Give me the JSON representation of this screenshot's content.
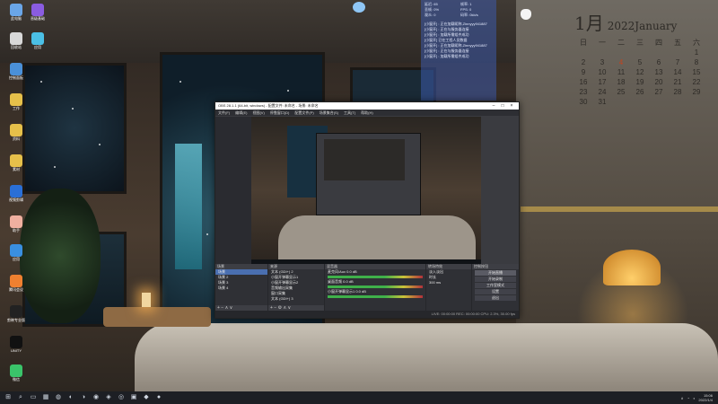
{
  "desktop": {
    "icons": [
      {
        "label": "此电脑",
        "color": "#6aa6e8"
      },
      {
        "label": "晋级基础",
        "color": "#8a5ce0"
      },
      {
        "label": "回收站",
        "color": "#d8d8d8"
      },
      {
        "label": "应用",
        "color": "#4bc0e6"
      },
      {
        "label": "控制面板",
        "color": "#4a90d8"
      },
      {
        "label": "工作",
        "color": "#e6c04a"
      },
      {
        "label": "资料",
        "color": "#e6c04a"
      },
      {
        "label": "素材",
        "color": "#e6c04a"
      },
      {
        "label": "视频剪辑",
        "color": "#2a6fd6"
      },
      {
        "label": "助手",
        "color": "#f0b0a0"
      },
      {
        "label": "应用",
        "color": "#3a8fe0"
      },
      {
        "label": "腾讯会议",
        "color": "#f08030"
      },
      {
        "label": "剪映专业版",
        "color": "#222222"
      },
      {
        "label": "UNITY",
        "color": "#111111"
      },
      {
        "label": "微信",
        "color": "#3ac46a"
      }
    ]
  },
  "calendar": {
    "month": "1月",
    "year_label": "2022January",
    "weekdays": [
      "日",
      "一",
      "二",
      "三",
      "四",
      "五",
      "六"
    ],
    "days": [
      "",
      "",
      "",
      "",
      "",
      "",
      "1",
      "2",
      "3",
      "4",
      "5",
      "6",
      "7",
      "8",
      "9",
      "10",
      "11",
      "12",
      "13",
      "14",
      "15",
      "16",
      "17",
      "18",
      "19",
      "20",
      "21",
      "22",
      "23",
      "24",
      "25",
      "26",
      "27",
      "28",
      "29",
      "30",
      "31",
      "",
      "",
      "",
      "",
      ""
    ],
    "highlight": "4"
  },
  "overlay": {
    "stats": [
      "延迟: 65",
      "帧率: 1",
      "丢帧: 0%",
      "FPS: 0",
      "观众: 0",
      "码率: 0kb/s"
    ],
    "messages": [
      "[小窗开] : 正在加载昵称,Zinnyyy941887",
      "[小窗开] : 正在与服务器连接",
      "[小窗开] : 加载所需组件成功",
      "[小窗开] 已在工程人员数据",
      "[小窗开] : 正在加载昵称,Zinnyyy941887",
      "[小窗开] : 正在与服务器连接",
      "[小窗开] : 加载所需组件成功"
    ]
  },
  "obs": {
    "title": "OBS 28.1.1 (64-bit, windows) - 配置文件: 未命名 - 场景: 未命名",
    "menu": [
      "文件(F)",
      "编辑(E)",
      "视图(V)",
      "停靠窗口(D)",
      "配置文件(P)",
      "场景集合(S)",
      "工具(T)",
      "帮助(H)"
    ],
    "docks": {
      "scenes": {
        "header": "场景",
        "items": [
          "场景",
          "场景 2",
          "场景 3",
          "场景 4"
        ]
      },
      "sources": {
        "header": "来源",
        "items": [
          "文本 (GDI+) 2",
          "小窗开弹幕显示1",
          "小窗开弹幕显示2",
          "音频输出采集",
          "窗口采集",
          "文本 (GDI+) 3"
        ]
      },
      "mixer": {
        "header": "混音器",
        "items": [
          "麦克风/Aux",
          "桌面音频",
          "小窗开弹幕显示1"
        ],
        "levels": [
          "0.0 dB",
          "0.0 dB",
          "0.0 dB"
        ]
      },
      "transitions": {
        "header": "转场特效",
        "items": [
          "淡入淡出",
          "时长",
          "300 ms"
        ]
      },
      "controls": {
        "header": "控制按钮",
        "buttons": [
          "开始直播",
          "开始录制",
          "工作室模式",
          "设置",
          "退出"
        ]
      }
    },
    "status": "LIVE: 00:00:00  REC: 00:00:00  CPU: 2.3%, 30.00 fps"
  },
  "taskbar": {
    "icons": [
      "⊞",
      "⌕",
      "▭",
      "▦",
      "◍",
      "◐",
      "◑",
      "◉",
      "◈",
      "◎",
      "▣",
      "◆",
      "●"
    ],
    "time": "15:06",
    "date": "2022/1/4"
  }
}
